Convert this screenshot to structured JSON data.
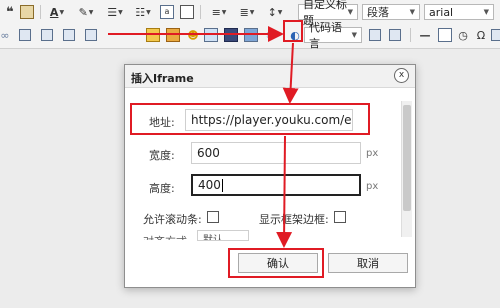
{
  "toolbar": {
    "quote_glyph": "66",
    "font_color_label": "A",
    "heading_combo": {
      "value": "自定义标题"
    },
    "paragraph_combo": {
      "value": "段落"
    },
    "font_combo": {
      "value": "arial"
    },
    "code_combo": {
      "value": "代码语言"
    }
  },
  "dialog": {
    "title": "插入Iframe",
    "close_symbol": "x",
    "address_label": "地址:",
    "address_value": "https://player.youku.com/embed/X",
    "width_label": "宽度:",
    "width_value": "600",
    "width_unit": "px",
    "height_label": "高度:",
    "height_value": "400",
    "height_unit": "px",
    "scroll_label": "允许滚动条:",
    "border_label": "显示框架边框:",
    "partial_label": "对齐方式",
    "partial_select_value": "默认",
    "ok_label": "确认",
    "cancel_label": "取消"
  },
  "colors": {
    "highlight": "#e01b24",
    "toolbar_bg": "#f3f3f3",
    "canvas_bg": "#ececec"
  },
  "icons": [
    "quote-icon",
    "paste-icon",
    "font-color-icon",
    "highlight-icon",
    "ordered-list-icon",
    "unordered-list-icon",
    "select-all-icon",
    "clear-format-icon",
    "align-icon",
    "line-height-icon",
    "image-icon",
    "emotion-icon",
    "map-icon",
    "video-icon",
    "iframe-icon",
    "table-icon",
    "horizontal-rule-icon",
    "date-icon",
    "time-icon",
    "special-char-icon",
    "print-icon",
    "preview-icon"
  ]
}
